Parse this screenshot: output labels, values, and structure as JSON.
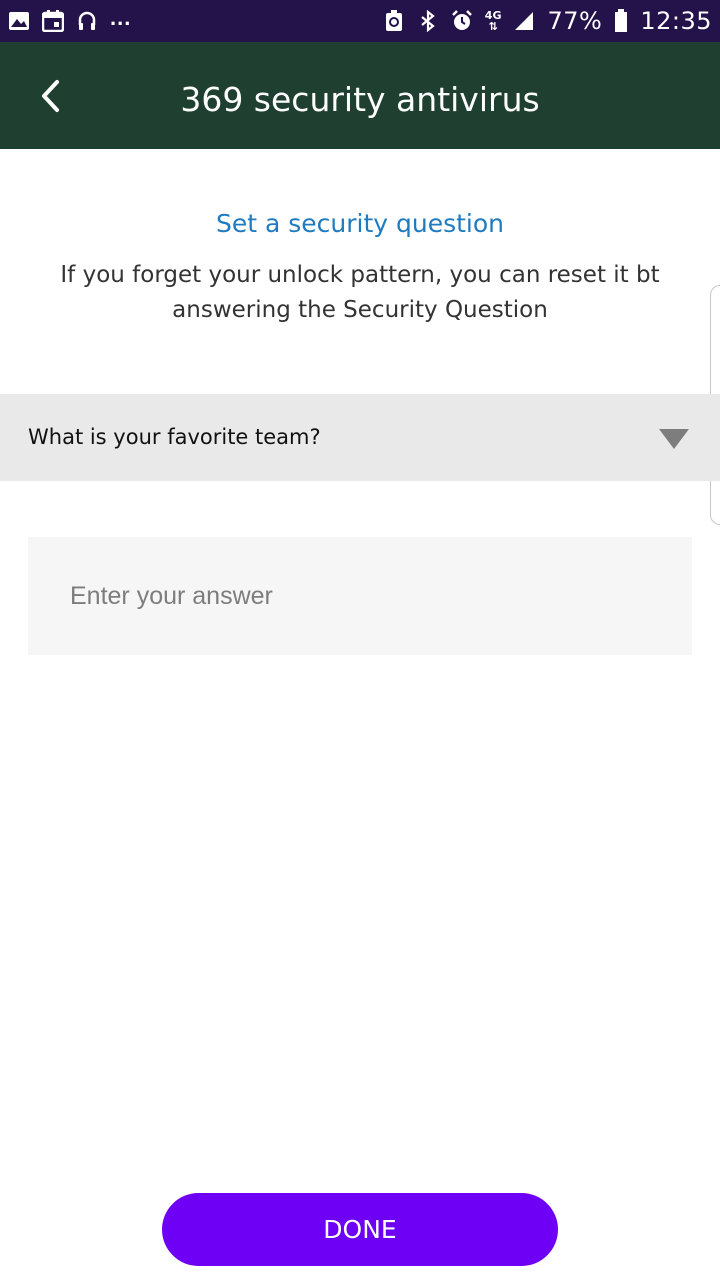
{
  "status_bar": {
    "icons": [
      "gallery-icon",
      "calendar-icon",
      "headset-icon",
      "more-icon",
      "battery-saver-icon",
      "bluetooth-icon",
      "alarm-icon",
      "network-4g-icon",
      "signal-icon",
      "battery-icon"
    ],
    "more_indicator": "...",
    "network_label": "4G",
    "battery_percent": "77%",
    "time": "12:35"
  },
  "app_bar": {
    "title": "369 security antivirus",
    "back_icon": "chevron-left-icon",
    "background_color": "#1f4030"
  },
  "content": {
    "heading": "Set a security question",
    "description": "If you forget your unlock pattern, you can reset it bt answering the Security Question",
    "question": {
      "selected": "What is your favorite team?",
      "arrow_icon": "triangle-down-icon"
    },
    "answer": {
      "value": "",
      "placeholder": "Enter your answer"
    }
  },
  "done_button": {
    "label": "DONE",
    "color": "#6e00f5"
  },
  "colors": {
    "status_bar": "#24124a",
    "heading": "#1f7bbf",
    "dropdown_bg": "#e9e9e9",
    "input_bg": "#f6f6f6"
  }
}
